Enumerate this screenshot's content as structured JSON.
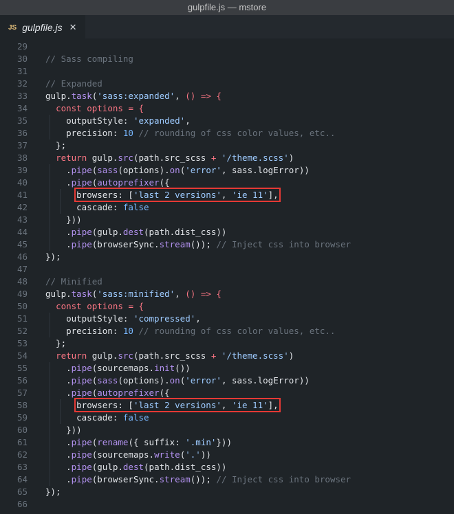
{
  "window": {
    "title": "gulpfile.js — mstore"
  },
  "tab": {
    "icon_label": "JS",
    "filename": "gulpfile.js",
    "close_glyph": "✕"
  },
  "lines": [
    {
      "n": "29",
      "tokens": []
    },
    {
      "n": "30",
      "tokens": [
        [
          "cm",
          "// Sass compiling"
        ]
      ]
    },
    {
      "n": "31",
      "tokens": []
    },
    {
      "n": "32",
      "tokens": [
        [
          "cm",
          "// Expanded"
        ]
      ]
    },
    {
      "n": "33",
      "tokens": [
        [
          "",
          "gulp."
        ],
        [
          "fn",
          "task"
        ],
        [
          "",
          "("
        ],
        [
          "str",
          "'sass:expanded'"
        ],
        [
          "",
          ", "
        ],
        [
          "kw",
          "()"
        ],
        [
          "",
          ""
        ],
        [
          "kw",
          " =>"
        ],
        [
          "",
          ""
        ],
        [
          "kw",
          " {"
        ]
      ]
    },
    {
      "n": "34",
      "tokens": [
        [
          "",
          "  "
        ],
        [
          "kw",
          "const"
        ],
        [
          "",
          ""
        ],
        [
          "kw",
          " options"
        ],
        [
          "",
          ""
        ],
        [
          "kw",
          " ="
        ],
        [
          "",
          ""
        ],
        [
          "kw",
          " {"
        ]
      ]
    },
    {
      "n": "35",
      "tokens": [
        [
          "",
          "    outputStyle: "
        ],
        [
          "str",
          "'expanded'"
        ],
        [
          "",
          ","
        ]
      ]
    },
    {
      "n": "36",
      "tokens": [
        [
          "",
          "    precision: "
        ],
        [
          "num",
          "10"
        ],
        [
          "",
          ""
        ],
        [
          "cm",
          " // rounding of css color values, etc.."
        ]
      ]
    },
    {
      "n": "37",
      "tokens": [
        [
          "",
          "  };"
        ]
      ]
    },
    {
      "n": "38",
      "tokens": [
        [
          "",
          "  "
        ],
        [
          "kw",
          "return"
        ],
        [
          "",
          ""
        ],
        [
          "",
          " gulp."
        ],
        [
          "fn",
          "src"
        ],
        [
          "",
          "(path.src_scss "
        ],
        [
          "kw",
          "+"
        ],
        [
          "",
          ""
        ],
        [
          "str",
          " '/theme.scss'"
        ],
        [
          "",
          ")"
        ]
      ]
    },
    {
      "n": "39",
      "tokens": [
        [
          "",
          "    ."
        ],
        [
          "fn",
          "pipe"
        ],
        [
          "",
          "("
        ],
        [
          "fn",
          "sass"
        ],
        [
          "",
          "(options)."
        ],
        [
          "fn",
          "on"
        ],
        [
          "",
          "("
        ],
        [
          "str",
          "'error'"
        ],
        [
          "",
          ", sass.logError))"
        ]
      ]
    },
    {
      "n": "40",
      "tokens": [
        [
          "",
          "    ."
        ],
        [
          "fn",
          "pipe"
        ],
        [
          "",
          "("
        ],
        [
          "fn",
          "autoprefixer"
        ],
        [
          "",
          "({"
        ]
      ]
    },
    {
      "n": "41",
      "hl": true,
      "tokens": [
        [
          "",
          "      browsers: ["
        ],
        [
          "str",
          "'last 2 versions'"
        ],
        [
          "",
          ", "
        ],
        [
          "str",
          "'ie 11'"
        ],
        [
          "",
          "],"
        ]
      ]
    },
    {
      "n": "42",
      "tokens": [
        [
          "",
          "      cascade: "
        ],
        [
          "num",
          "false"
        ]
      ]
    },
    {
      "n": "43",
      "tokens": [
        [
          "",
          "    }))"
        ]
      ]
    },
    {
      "n": "44",
      "tokens": [
        [
          "",
          "    ."
        ],
        [
          "fn",
          "pipe"
        ],
        [
          "",
          "(gulp."
        ],
        [
          "fn",
          "dest"
        ],
        [
          "",
          "(path.dist_css))"
        ]
      ]
    },
    {
      "n": "45",
      "tokens": [
        [
          "",
          "    ."
        ],
        [
          "fn",
          "pipe"
        ],
        [
          "",
          "(browserSync."
        ],
        [
          "fn",
          "stream"
        ],
        [
          "",
          "()); "
        ],
        [
          "cm",
          "// Inject css into browser"
        ]
      ]
    },
    {
      "n": "46",
      "tokens": [
        [
          "",
          "});"
        ]
      ]
    },
    {
      "n": "47",
      "tokens": []
    },
    {
      "n": "48",
      "tokens": [
        [
          "cm",
          "// Minified"
        ]
      ]
    },
    {
      "n": "49",
      "tokens": [
        [
          "",
          "gulp."
        ],
        [
          "fn",
          "task"
        ],
        [
          "",
          "("
        ],
        [
          "str",
          "'sass:minified'"
        ],
        [
          "",
          ", "
        ],
        [
          "kw",
          "()"
        ],
        [
          "",
          ""
        ],
        [
          "kw",
          " =>"
        ],
        [
          "",
          ""
        ],
        [
          "kw",
          " {"
        ]
      ]
    },
    {
      "n": "50",
      "tokens": [
        [
          "",
          "  "
        ],
        [
          "kw",
          "const"
        ],
        [
          "",
          ""
        ],
        [
          "kw",
          " options"
        ],
        [
          "",
          ""
        ],
        [
          "kw",
          " ="
        ],
        [
          "",
          ""
        ],
        [
          "kw",
          " {"
        ]
      ]
    },
    {
      "n": "51",
      "tokens": [
        [
          "",
          "    outputStyle: "
        ],
        [
          "str",
          "'compressed'"
        ],
        [
          "",
          ","
        ]
      ]
    },
    {
      "n": "52",
      "tokens": [
        [
          "",
          "    precision: "
        ],
        [
          "num",
          "10"
        ],
        [
          "",
          ""
        ],
        [
          "cm",
          " // rounding of css color values, etc.."
        ]
      ]
    },
    {
      "n": "53",
      "tokens": [
        [
          "",
          "  };"
        ]
      ]
    },
    {
      "n": "54",
      "tokens": [
        [
          "",
          "  "
        ],
        [
          "kw",
          "return"
        ],
        [
          "",
          ""
        ],
        [
          "",
          " gulp."
        ],
        [
          "fn",
          "src"
        ],
        [
          "",
          "(path.src_scss "
        ],
        [
          "kw",
          "+"
        ],
        [
          "",
          ""
        ],
        [
          "str",
          " '/theme.scss'"
        ],
        [
          "",
          ")"
        ]
      ]
    },
    {
      "n": "55",
      "tokens": [
        [
          "",
          "    ."
        ],
        [
          "fn",
          "pipe"
        ],
        [
          "",
          "(sourcemaps."
        ],
        [
          "fn",
          "init"
        ],
        [
          "",
          "())"
        ]
      ]
    },
    {
      "n": "56",
      "tokens": [
        [
          "",
          "    ."
        ],
        [
          "fn",
          "pipe"
        ],
        [
          "",
          "("
        ],
        [
          "fn",
          "sass"
        ],
        [
          "",
          "(options)."
        ],
        [
          "fn",
          "on"
        ],
        [
          "",
          "("
        ],
        [
          "str",
          "'error'"
        ],
        [
          "",
          ", sass.logError))"
        ]
      ]
    },
    {
      "n": "57",
      "tokens": [
        [
          "",
          "    ."
        ],
        [
          "fn",
          "pipe"
        ],
        [
          "",
          "("
        ],
        [
          "fn",
          "autoprefixer"
        ],
        [
          "",
          "({"
        ]
      ]
    },
    {
      "n": "58",
      "hl": true,
      "tokens": [
        [
          "",
          "      browsers: ["
        ],
        [
          "str",
          "'last 2 versions'"
        ],
        [
          "",
          ", "
        ],
        [
          "str",
          "'ie 11'"
        ],
        [
          "",
          "],"
        ]
      ]
    },
    {
      "n": "59",
      "tokens": [
        [
          "",
          "      cascade: "
        ],
        [
          "num",
          "false"
        ]
      ]
    },
    {
      "n": "60",
      "tokens": [
        [
          "",
          "    }))"
        ]
      ]
    },
    {
      "n": "61",
      "tokens": [
        [
          "",
          "    ."
        ],
        [
          "fn",
          "pipe"
        ],
        [
          "",
          "("
        ],
        [
          "fn",
          "rename"
        ],
        [
          "",
          "({ suffix: "
        ],
        [
          "str",
          "'.min'"
        ],
        [
          "",
          "}))"
        ]
      ]
    },
    {
      "n": "62",
      "tokens": [
        [
          "",
          "    ."
        ],
        [
          "fn",
          "pipe"
        ],
        [
          "",
          "(sourcemaps."
        ],
        [
          "fn",
          "write"
        ],
        [
          "",
          "("
        ],
        [
          "str",
          "'.'"
        ],
        [
          "",
          "))"
        ]
      ]
    },
    {
      "n": "63",
      "tokens": [
        [
          "",
          "    ."
        ],
        [
          "fn",
          "pipe"
        ],
        [
          "",
          "(gulp."
        ],
        [
          "fn",
          "dest"
        ],
        [
          "",
          "(path.dist_css))"
        ]
      ]
    },
    {
      "n": "64",
      "tokens": [
        [
          "",
          "    ."
        ],
        [
          "fn",
          "pipe"
        ],
        [
          "",
          "(browserSync."
        ],
        [
          "fn",
          "stream"
        ],
        [
          "",
          "()); "
        ],
        [
          "cm",
          "// Inject css into browser"
        ]
      ]
    },
    {
      "n": "65",
      "tokens": [
        [
          "",
          "});"
        ]
      ]
    },
    {
      "n": "66",
      "tokens": []
    }
  ]
}
